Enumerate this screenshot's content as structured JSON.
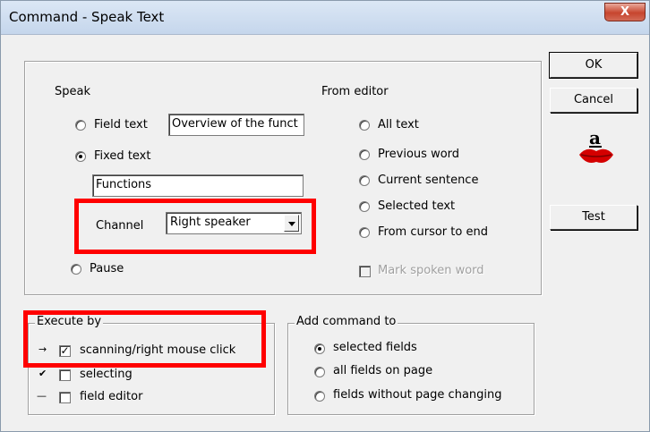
{
  "window": {
    "title": "Command - Speak Text",
    "close_label": "X"
  },
  "buttons": {
    "ok": "OK",
    "cancel": "Cancel",
    "test": "Test"
  },
  "speak": {
    "heading": "Speak",
    "field_text_label": "Field text",
    "field_text_value": "Overview of the funct",
    "fixed_text_label": "Fixed text",
    "fixed_text_value": "Functions",
    "channel_label": "Channel",
    "channel_value": "Right speaker",
    "pause_label": "Pause"
  },
  "from_editor": {
    "heading": "From editor",
    "options": [
      "All text",
      "Previous word",
      "Current sentence",
      "Selected text",
      "From cursor to end"
    ],
    "mark_spoken_word": "Mark spoken word"
  },
  "execute_by": {
    "legend": "Execute by",
    "items": [
      {
        "symbol": "→",
        "label": "scanning/right mouse click",
        "checked": true
      },
      {
        "symbol": "✔",
        "label": "selecting",
        "checked": false
      },
      {
        "symbol": "—",
        "label": "field editor",
        "checked": false
      }
    ]
  },
  "add_command_to": {
    "legend": "Add command to",
    "options": [
      "selected fields",
      "all fields on page",
      "fields without page changing"
    ]
  },
  "icon": {
    "name": "speaking-mouth-icon",
    "letter": "a"
  },
  "colors": {
    "highlight": "#ff0000",
    "dialog_bg": "#f0f0f0",
    "mouth_red": "#d40000"
  }
}
